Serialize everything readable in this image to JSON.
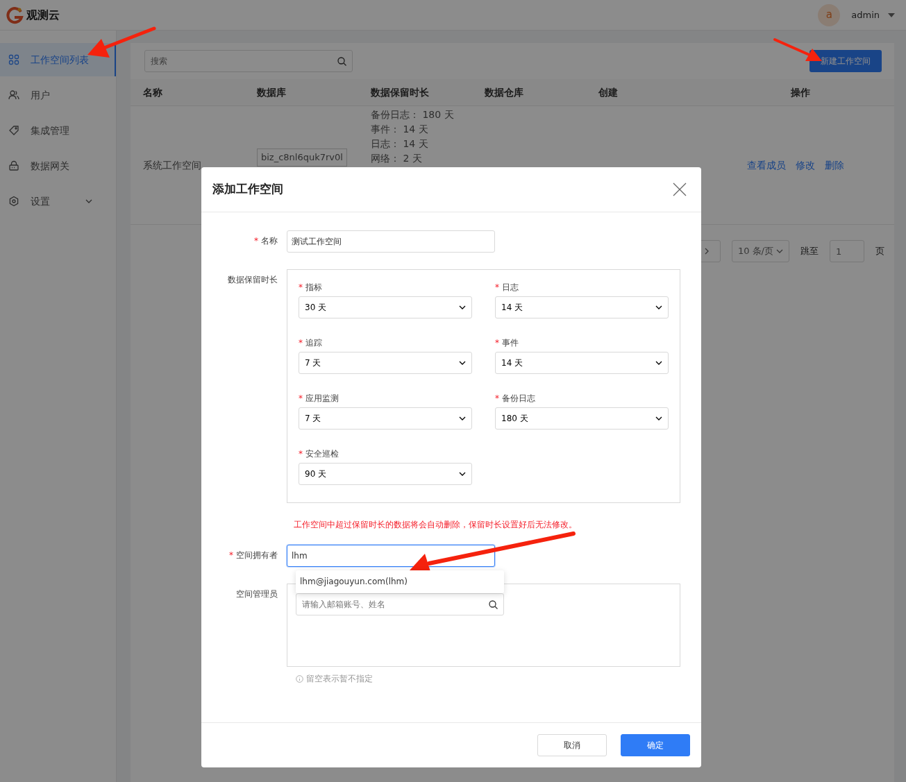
{
  "header": {
    "logo_text": "观测云",
    "user": {
      "avatar_letter": "a",
      "name": "admin"
    }
  },
  "sidebar": {
    "items": [
      {
        "label": "工作空间列表",
        "selected": true,
        "has_submenu": false
      },
      {
        "label": "用户",
        "selected": false,
        "has_submenu": false
      },
      {
        "label": "集成管理",
        "selected": false,
        "has_submenu": false
      },
      {
        "label": "数据网关",
        "selected": false,
        "has_submenu": false
      },
      {
        "label": "设置",
        "selected": false,
        "has_submenu": true
      }
    ]
  },
  "toolbar": {
    "search": {
      "placeholder": "搜索"
    },
    "new_button": "新建工作空间"
  },
  "table": {
    "columns": [
      "名称",
      "数据库",
      "数据保留时长",
      "数据仓库",
      "创建",
      "操作"
    ],
    "rows": [
      {
        "name": "系统工作空间",
        "database": "biz_c8nl6quk7rv0l",
        "retention": [
          {
            "label": "备份日志：",
            "value": "180 天"
          },
          {
            "label": "事件：",
            "value": "14 天"
          },
          {
            "label": "日志：",
            "value": "14 天"
          },
          {
            "label": "网络：",
            "value": "2 天"
          }
        ],
        "actions": [
          "查看成员",
          "修改",
          "删除"
        ]
      }
    ]
  },
  "pagination": {
    "page_size": "10 条/页",
    "jump_label": "跳至",
    "jump_value": "1",
    "page_suffix": "页"
  },
  "modal": {
    "title": "添加工作空间",
    "name_field": {
      "label": "名称",
      "required_mark": "*",
      "value": "测试工作空间"
    },
    "retention": {
      "label": "数据保留时长",
      "items": [
        {
          "label": "指标",
          "required_mark": "*",
          "value": "30 天"
        },
        {
          "label": "日志",
          "required_mark": "*",
          "value": "14 天"
        },
        {
          "label": "追踪",
          "required_mark": "*",
          "value": "7 天"
        },
        {
          "label": "事件",
          "required_mark": "*",
          "value": "14 天"
        },
        {
          "label": "应用监测",
          "required_mark": "*",
          "value": "7 天"
        },
        {
          "label": "备份日志",
          "required_mark": "*",
          "value": "180 天"
        },
        {
          "label": "安全巡检",
          "required_mark": "*",
          "value": "90 天"
        }
      ]
    },
    "warning": "工作空间中超过保留时长的数据将会自动删除，保留时长设置好后无法修改。",
    "owner_field": {
      "label": "空间拥有者",
      "required_mark": "*",
      "value": "lhm",
      "focused": true,
      "suggestions": [
        "lhm@jiagouyun.com(lhm)"
      ]
    },
    "admins_field": {
      "label": "空间管理员",
      "placeholder": "请输入邮箱账号、姓名"
    },
    "hint": "留空表示暂不指定",
    "buttons": [
      {
        "label": "取消",
        "kind": "secondary"
      },
      {
        "label": "确定",
        "kind": "primary"
      }
    ]
  }
}
